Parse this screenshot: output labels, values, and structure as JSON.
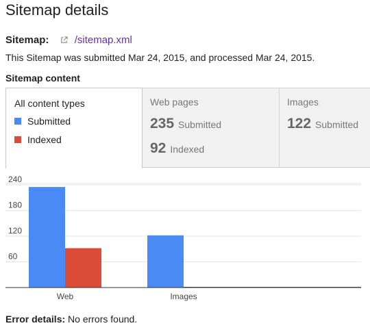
{
  "page": {
    "title": "Sitemap details",
    "sitemap_label": "Sitemap:",
    "sitemap_link": "/sitemap.xml",
    "submitted_text": "This Sitemap was submitted Mar 24, 2015, and processed Mar 24, 2015.",
    "section_title": "Sitemap content"
  },
  "tabs": {
    "all": {
      "label": "All content types",
      "legend": [
        "Submitted",
        "Indexed"
      ]
    },
    "web": {
      "label": "Web pages",
      "submitted_count": "235",
      "submitted_word": "Submitted",
      "indexed_count": "92",
      "indexed_word": "Indexed"
    },
    "images": {
      "label": "Images",
      "submitted_count": "122",
      "submitted_word": "Submitted"
    }
  },
  "colors": {
    "submitted": "#4a8af4",
    "indexed": "#dc4a38",
    "link": "#6a2cb0"
  },
  "icons": {
    "external_link": "external-link-icon"
  },
  "chart_data": {
    "type": "bar",
    "categories": [
      "Web",
      "Images"
    ],
    "series": [
      {
        "name": "Submitted",
        "values": [
          235,
          122
        ]
      },
      {
        "name": "Indexed",
        "values": [
          92,
          0
        ]
      }
    ],
    "yticks": [
      60,
      120,
      180,
      240
    ],
    "ylim": [
      0,
      270
    ],
    "grid": true,
    "legend": "left"
  },
  "error": {
    "label": "Error details:",
    "text": "No errors found."
  }
}
